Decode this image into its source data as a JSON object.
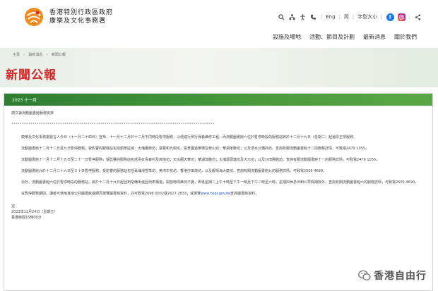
{
  "header": {
    "org_line1": "香港特別行政區政府",
    "org_line2": "康樂及文化事務署",
    "utility": {
      "icons": [
        "search-icon",
        "sitemap-icon",
        "accessibility-icon",
        "phone-icon"
      ],
      "lang_en": "Eng",
      "lang_sc": "简",
      "font_size": "字型大小",
      "share_icon": "share-icon"
    },
    "nav": [
      "設施及場地",
      "活動、節目及計劃",
      "最新消息",
      "關於我們"
    ]
  },
  "breadcrumb": [
    "主頁",
    "最新消息",
    "新聞公報"
  ],
  "page_title": "新聞公報",
  "panel": {
    "month": "2023 十一月",
    "release_title": "康文署流動圖書館服務安排",
    "stars": "************************************************************************************************",
    "paragraphs": [
      "康樂及文化事務署發言人今日（十一月二十四日）宣布，十一月十二月於十二月不同時段暫停服務，以便進行例行保養維修工程，而流動圖書館六位於暫停時段的服務站將於十二月十九日（星期二）起還原正常服務。",
      "流動圖書館十二月十二日至九日暫停服務，受影響的服務站包括順景區域：大埔畫廊坊；富豐和光樹坊，富景園遊樂場及泰山坊；華湖家聯坊；以及漢水沙灘商坊。查詢有關流動圖書館十二的服務詳情，可致電2479 1055。",
      "流動圖書館十一月十二月十五日至二十一日暫停服務，受影響的服務站包括青衣青森村及高灣坊；天水圍天華坊；華湖灣體坊；大埔運頭塘坊及大元坊；以及沙田團體坊。查詢有關流動圖書館十一的服務詳情，可致電2479 1055。",
      "流動圖書館九於十二月二十六日至三十日暫停服務，受影響的服務站包括黃埔滑雪草坊、美湾市花坊、香港仔田灣坊，以及銀禧海大廈坊。查詢有關流動圖書館九的服務詳情，可致電2505 4690。",
      "另外，流動圖書館六位於暫停時段的服務站，將於十二月十九日起回到常備街還回列表構進，開放時間維持不變，即逢星期二上午十時至下午一時及下午二時至六時，星期四休息日和公眾假期除外。查詢有關流動圖書館六的服務詳情，可致電2505 4690。",
      "在暫停服務期間，讀者可使用其他公共圖書館或網頁瀏覽圖書館資料，亦可致電2698 0002或2627 2833，或瀏覽"
    ],
    "link_text": "www.hkpl.gov.hk",
    "link_tail": "查詢圖書館資料。",
    "sign_end": "完",
    "sign_date": "2023年11月24日（星期五）",
    "sign_time": "香港時間15時00分"
  },
  "watermark": "香港自由行",
  "colors": {
    "panel_head_green": "#2e7d32",
    "title_red": "#d72626",
    "link_blue": "#1a4ad8",
    "facebook_blue": "#1877f2"
  }
}
